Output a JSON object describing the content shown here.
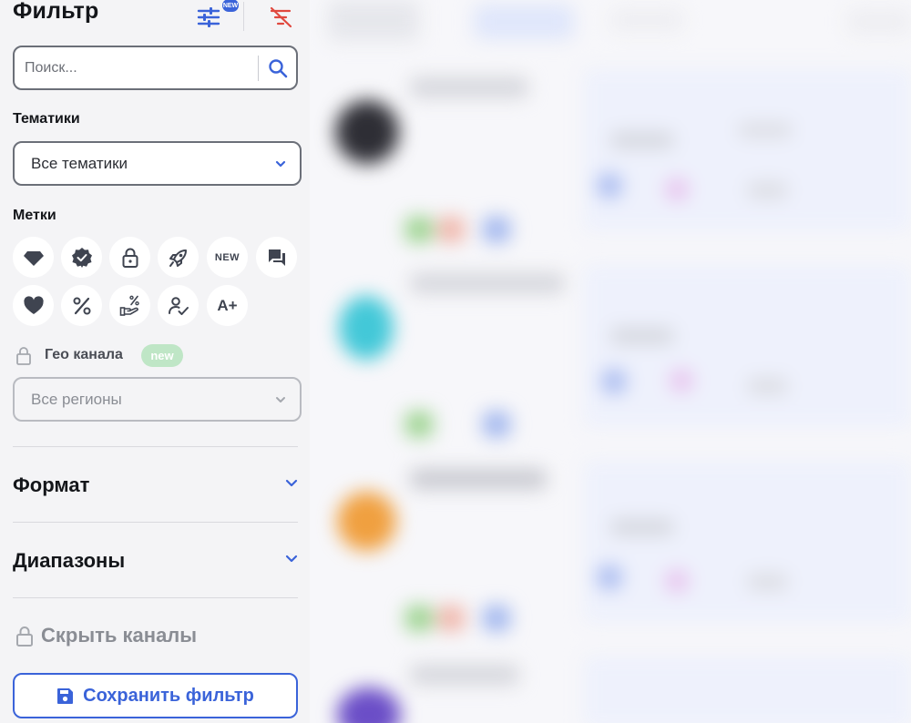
{
  "filter": {
    "title": "Фильтр",
    "settings_badge": "NEW",
    "search": {
      "placeholder": "Поиск..."
    },
    "themes": {
      "label": "Тематики",
      "selected": "Все тематики"
    },
    "tags": {
      "label": "Метки",
      "items": [
        {
          "icon": "diamond-icon"
        },
        {
          "icon": "verified-badge-icon"
        },
        {
          "icon": "lock-icon"
        },
        {
          "icon": "rocket-icon"
        },
        {
          "icon": "new-icon",
          "text": "NEW"
        },
        {
          "icon": "chat-icon"
        },
        {
          "icon": "heart-icon"
        },
        {
          "icon": "percent-icon"
        },
        {
          "icon": "hand-percent-icon"
        },
        {
          "icon": "person-check-icon"
        },
        {
          "icon": "a-plus-icon",
          "text": "A+"
        }
      ]
    },
    "geo": {
      "label": "Гео канала",
      "badge": "new",
      "selected": "Все регионы"
    },
    "sections": [
      {
        "title": "Формат"
      },
      {
        "title": "Диапазоны"
      }
    ],
    "hide_channels": "Скрыть каналы",
    "save_button": "Сохранить фильтр"
  },
  "colors": {
    "accent": "#3a63d9",
    "clear_filter": "#e0483e",
    "new_green": "#bfe6c6",
    "text_dark": "#14161a"
  }
}
